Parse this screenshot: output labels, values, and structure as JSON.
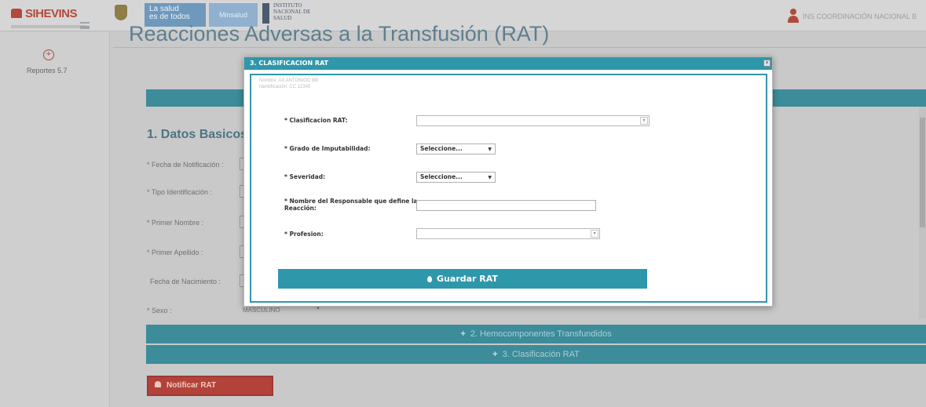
{
  "header": {
    "logo_text": "SIHEVINS",
    "gov_line1": "La salud",
    "gov_line2": "es de todos",
    "minsalud_text": "Minsalud",
    "ins_line1": "INSTITUTO",
    "ins_line2": "NACIONAL DE",
    "ins_line3": "SALUD",
    "user_text": "INS COORDINACIÓN NACIONAL B"
  },
  "sidebar": {
    "reportes_label": "Reportes 5.7"
  },
  "page": {
    "title": "Reacciones Adversas a la Transfusión (RAT)",
    "section_title": "1. Datos Basicos",
    "fields": [
      {
        "label": "* Fecha de Notificación :"
      },
      {
        "label": "* Tipo Identificación :"
      },
      {
        "label": "* Primer Nombre :"
      },
      {
        "label": "* Primer Apellido :"
      },
      {
        "label": "Fecha de Nacimiento :"
      },
      {
        "label": "* Sexo :"
      }
    ],
    "sexo_value": "MASCULINO",
    "accordion": [
      {
        "label": "2. Hemocomponentes Transfundidos"
      },
      {
        "label": "3. Clasificación RAT"
      }
    ],
    "notify_button": "Notificar RAT"
  },
  "modal": {
    "title": "3. CLASIFICACION RAT",
    "close_symbol": "×",
    "patient_name": "Nombre: AX ANTONIOO BB",
    "patient_id": "Identificación: CC 12345",
    "fields": {
      "clasificacion_label": "* Clasificacion RAT:",
      "imputabilidad_label": "* Grado de Imputabilidad:",
      "imputabilidad_value": "Seleccione...",
      "severidad_label": "* Severidad:",
      "severidad_value": "Seleccione...",
      "responsable_label_line1": "* Nombre del Responsable que define la",
      "responsable_label_line2": "Reacción:",
      "profesion_label": "* Profesion:"
    },
    "save_button": "Guardar RAT"
  },
  "colors": {
    "teal": "#2f97aa",
    "brand_red": "#b14a3c",
    "title_blue": "#5d7f8e"
  },
  "icons": [
    "colombia-shield-icon",
    "user-icon",
    "menu-icon",
    "plus-circle-icon",
    "close-icon",
    "dropdown-arrow-icon",
    "plus-icon",
    "bell-icon",
    "drop-icon"
  ]
}
